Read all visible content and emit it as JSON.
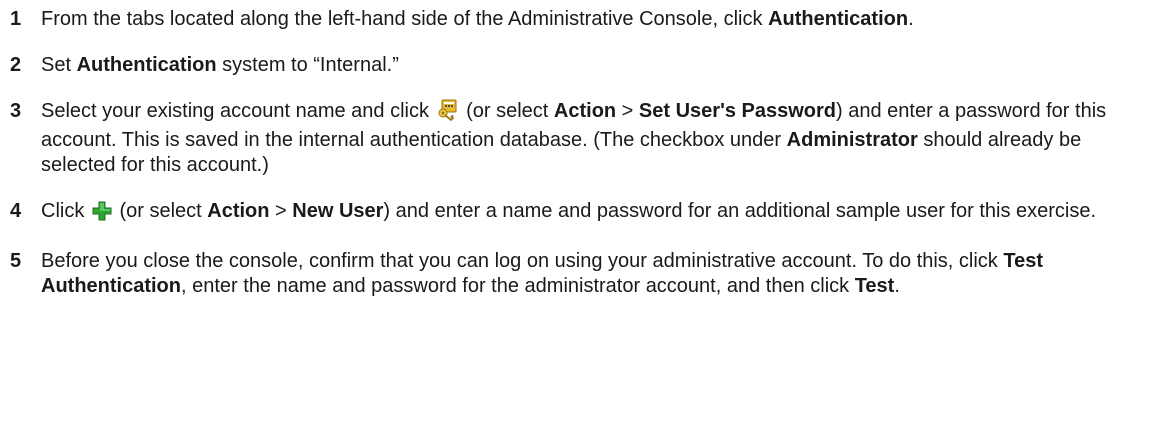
{
  "steps": [
    {
      "number": "1",
      "t1": "From the tabs located along the left-hand side of the Administrative Console, click ",
      "b1": "Authentication",
      "t2": "."
    },
    {
      "number": "2",
      "t1": "Set ",
      "b1": "Authentication",
      "t2": " system to “Internal.”"
    },
    {
      "number": "3",
      "t1": "Select your existing account name and click ",
      "icon": "set-password-icon",
      "t2": " (or select ",
      "b1": "Action",
      "t3": " > ",
      "b2": "Set User's Password",
      "t4": ") and enter a password for this account. This is saved in the internal authentication database. (The checkbox under ",
      "b3": "Administrator",
      "t5": " should already be selected for this account.)"
    },
    {
      "number": "4",
      "t1": "Click ",
      "icon": "new-user-plus-icon",
      "t2": " (or select ",
      "b1": "Action",
      "t3": " > ",
      "b2": "New User",
      "t4": ") and enter a name and password for an additional sample user for this exercise."
    },
    {
      "number": "5",
      "t1": "Before you close the console, confirm that you can log on using your administrative account. To do this, click ",
      "b1": "Test Authentication",
      "t2": ", enter the name and password for the administrator account, and then click ",
      "b2": "Test",
      "t3": "."
    }
  ],
  "colors": {
    "text": "#1a1a1a",
    "plus_icon_green": "#2fa531",
    "password_icon_yellow": "#e8b830"
  }
}
